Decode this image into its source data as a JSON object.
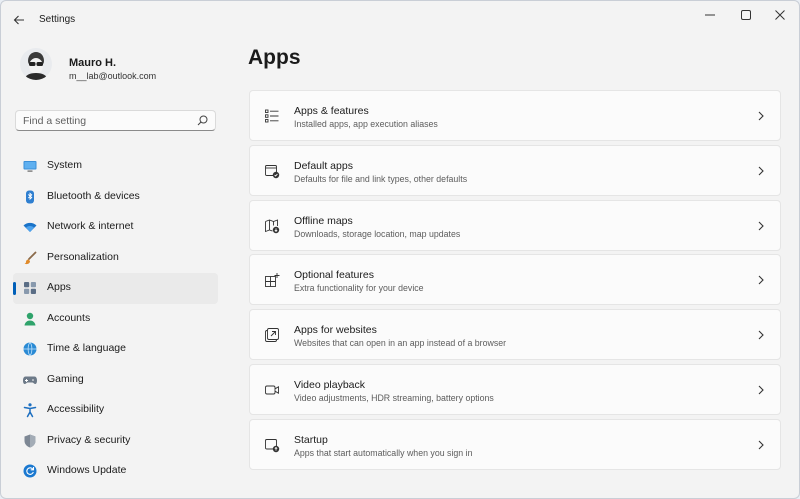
{
  "window": {
    "title": "Settings"
  },
  "profile": {
    "name": "Mauro H.",
    "email": "m__lab@outlook.com"
  },
  "search": {
    "placeholder": "Find a setting"
  },
  "sidebar": {
    "items": [
      {
        "label": "System",
        "icon": "monitor-icon",
        "active": false
      },
      {
        "label": "Bluetooth & devices",
        "icon": "bluetooth-icon",
        "active": false
      },
      {
        "label": "Network & internet",
        "icon": "wifi-icon",
        "active": false
      },
      {
        "label": "Personalization",
        "icon": "brush-icon",
        "active": false
      },
      {
        "label": "Apps",
        "icon": "apps-icon",
        "active": true
      },
      {
        "label": "Accounts",
        "icon": "person-icon",
        "active": false
      },
      {
        "label": "Time & language",
        "icon": "globe-clock-icon",
        "active": false
      },
      {
        "label": "Gaming",
        "icon": "gamepad-icon",
        "active": false
      },
      {
        "label": "Accessibility",
        "icon": "accessibility-icon",
        "active": false
      },
      {
        "label": "Privacy & security",
        "icon": "shield-icon",
        "active": false
      },
      {
        "label": "Windows Update",
        "icon": "update-icon",
        "active": false
      }
    ]
  },
  "main": {
    "title": "Apps",
    "cards": [
      {
        "title": "Apps & features",
        "subtitle": "Installed apps, app execution aliases",
        "icon": "list-icon"
      },
      {
        "title": "Default apps",
        "subtitle": "Defaults for file and link types, other defaults",
        "icon": "default-apps-icon"
      },
      {
        "title": "Offline maps",
        "subtitle": "Downloads, storage location, map updates",
        "icon": "map-download-icon"
      },
      {
        "title": "Optional features",
        "subtitle": "Extra functionality for your device",
        "icon": "grid-add-icon"
      },
      {
        "title": "Apps for websites",
        "subtitle": "Websites that can open in an app instead of a browser",
        "icon": "open-link-icon"
      },
      {
        "title": "Video playback",
        "subtitle": "Video adjustments, HDR streaming, battery options",
        "icon": "video-icon"
      },
      {
        "title": "Startup",
        "subtitle": "Apps that start automatically when you sign in",
        "icon": "startup-icon"
      }
    ]
  },
  "colors": {
    "accent": "#005fb8",
    "background": "#f3f3f3",
    "card": "#fbfbfb"
  }
}
